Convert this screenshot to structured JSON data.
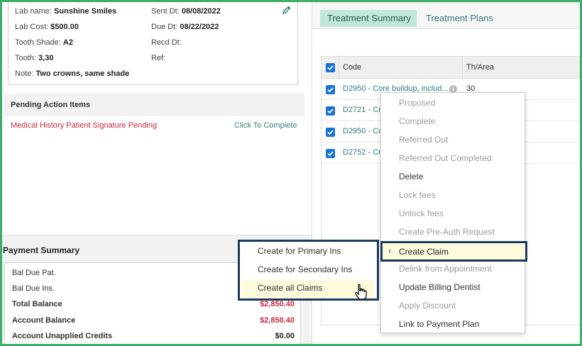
{
  "lab": {
    "name_label": "Lab name:",
    "name_value": "Sunshine Smiles",
    "cost_label": "Lab Cost:",
    "cost_value": "$500.00",
    "shade_label": "Tooth Shade:",
    "shade_value": "A2",
    "tooth_label": "Tooth:",
    "tooth_value": "3,30",
    "note_label": "Note:",
    "note_value": "Two crowns, same shade",
    "sent_label": "Sent Dt:",
    "sent_value": "08/08/2022",
    "due_label": "Due Dt:",
    "due_value": "08/22/2022",
    "recd_label": "Recd Dt:",
    "ref_label": "Ref:"
  },
  "pending": {
    "title": "Pending Action Items",
    "item": "Medical History Patient Signature Pending",
    "action": "Click To Complete"
  },
  "payment": {
    "title": "Payment Summary",
    "rows": [
      {
        "label": "Bal Due Pat.",
        "value": ""
      },
      {
        "label": "Bal Due Ins.",
        "value": ""
      },
      {
        "label": "Total Balance",
        "value": "$2,850.40"
      },
      {
        "label": "Account Balance",
        "value": "$2,850.40"
      },
      {
        "label": "Account Unapplied Credits",
        "value": "$0.00"
      }
    ]
  },
  "tabs": {
    "active": "Treatment Summary",
    "other": "Treatment Plans"
  },
  "table": {
    "col_code": "Code",
    "col_area": "Th/Area",
    "rows": [
      {
        "code": "D2950 - Core buildup, includ...",
        "area": "30"
      },
      {
        "code": "D2721 - Cro",
        "area": ""
      },
      {
        "code": "D2950 - Co",
        "area": ""
      },
      {
        "code": "D2752 - Cro",
        "area": ""
      }
    ]
  },
  "context_menu": {
    "items": [
      {
        "label": "Proposed",
        "enabled": false
      },
      {
        "label": "Complete",
        "enabled": false
      },
      {
        "label": "Referred Out",
        "enabled": false
      },
      {
        "label": "Referred Out Completed",
        "enabled": false
      },
      {
        "label": "Delete",
        "enabled": true
      },
      {
        "label": "Lock fees",
        "enabled": false
      },
      {
        "label": "Unlock fees",
        "enabled": false
      },
      {
        "label": "Create Pre-Auth Request",
        "enabled": false
      },
      {
        "label": "Create Claim",
        "enabled": true
      },
      {
        "label": "Delink from Appointment",
        "enabled": false
      },
      {
        "label": "Update Billing Dentist",
        "enabled": true
      },
      {
        "label": "Apply Discount",
        "enabled": false
      },
      {
        "label": "Link to Payment Plan",
        "enabled": true
      }
    ]
  },
  "submenu": {
    "items": [
      "Create for Primary Ins",
      "Create for Secondary Ins",
      "Create all Claims"
    ]
  },
  "icons": {
    "edit": "pencil-icon",
    "info": "info-icon",
    "checkbox": "checkbox-checked-icon",
    "chevron": "chevron-left-icon",
    "cursor": "hand-pointer-icon"
  },
  "colors": {
    "frame": "#3fae6a",
    "highlight_border": "#1d3a5e",
    "highlight_fill": "#fdfbdc",
    "danger": "#c62b3c",
    "link": "#2f7a7a",
    "active_tab": "#bfe8d8"
  }
}
